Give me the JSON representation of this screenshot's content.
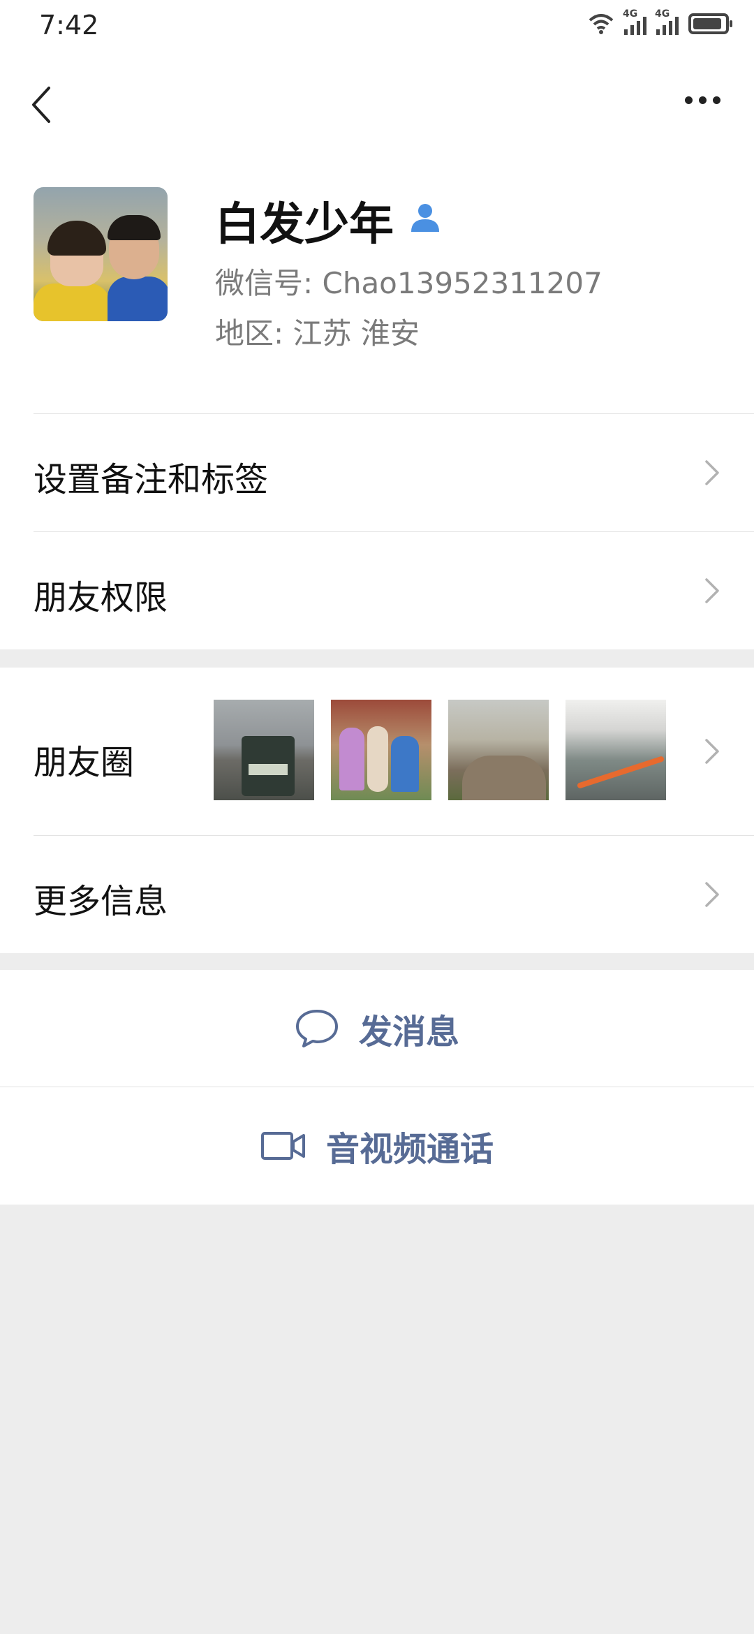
{
  "status_bar": {
    "time": "7:42",
    "network1": "4G",
    "network2": "4G"
  },
  "profile": {
    "name": "白发少年",
    "wechat_id": "微信号: Chao13952311207",
    "region": "地区: 江苏 淮安"
  },
  "menu": {
    "remarks_tags": "设置备注和标签",
    "friend_permissions": "朋友权限",
    "moments": "朋友圈",
    "more_info": "更多信息"
  },
  "actions": {
    "send_message": "发消息",
    "video_call": "音视频通话"
  },
  "colors": {
    "accent": "#576b95",
    "background": "#ededed",
    "verified_icon": "#4a90e2"
  },
  "icons": [
    "back-arrow-icon",
    "more-dots-icon",
    "person-icon",
    "chevron-right-icon",
    "chat-bubble-icon",
    "video-camera-icon"
  ]
}
